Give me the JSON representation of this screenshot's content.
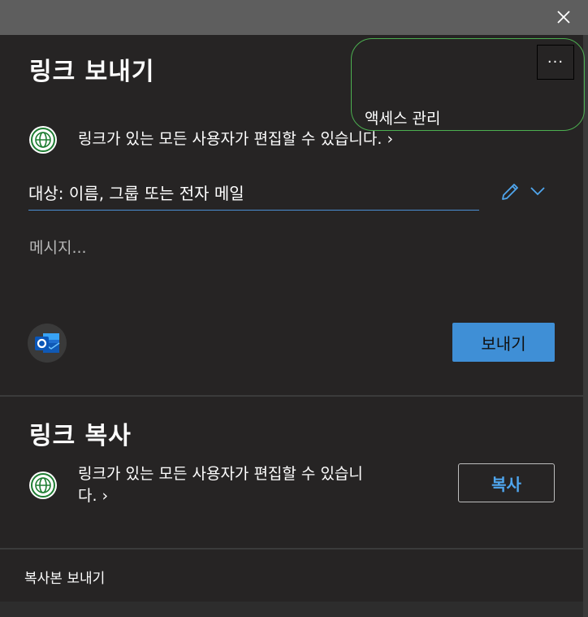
{
  "send_link": {
    "title": "링크 보내기",
    "permission_text": "링크가 있는 모든 사용자가 편집할 수 있습니다. ›",
    "recipient_placeholder": "대상: 이름, 그룹 또는 전자 메일",
    "message_placeholder": "메시지...",
    "send_label": "보내기"
  },
  "manage_access": {
    "more_label": "···",
    "label": "액세스 관리"
  },
  "copy_link": {
    "title": "링크 복사",
    "permission_line1": "링크가 있는 모든 사용자가 편집할 수 있습니",
    "permission_line2": "다. ›",
    "copy_label": "복사"
  },
  "footer": {
    "send_copy_label": "복사본 보내기"
  },
  "colors": {
    "accent": "#3f8fd6",
    "link_text": "#4fa6ee",
    "highlight_ring": "#4caf50",
    "globe_green": "#1e7d32"
  }
}
